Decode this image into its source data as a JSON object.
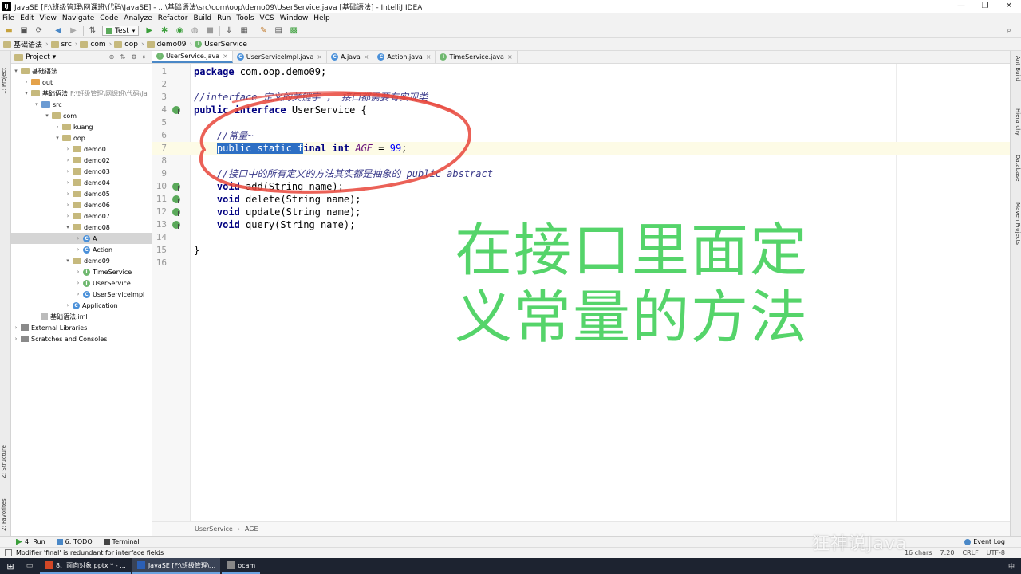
{
  "window": {
    "title": "JavaSE [F:\\班级管理\\网课班\\代码\\JavaSE] - ...\\基础语法\\src\\com\\oop\\demo09\\UserService.java [基础语法] - IntelliJ IDEA",
    "app_icon": "IJ"
  },
  "menu": [
    "File",
    "Edit",
    "View",
    "Navigate",
    "Code",
    "Analyze",
    "Refactor",
    "Build",
    "Run",
    "Tools",
    "VCS",
    "Window",
    "Help"
  ],
  "toolbar": {
    "run_config": "Test"
  },
  "breadcrumb": [
    "基础语法",
    "src",
    "com",
    "oop",
    "demo09",
    "UserService"
  ],
  "project_panel": {
    "title": "Project ▾",
    "tree": [
      {
        "label": "基础语法",
        "depth": 0,
        "arrow": "▾",
        "icon": "folder",
        "hint": ""
      },
      {
        "label": "out",
        "depth": 1,
        "arrow": "›",
        "icon": "folder-orange",
        "hint": ""
      },
      {
        "label": "基础语法",
        "depth": 1,
        "arrow": "▾",
        "icon": "folder",
        "hint": "F:\\班级管理\\网课班\\代码\\Ja"
      },
      {
        "label": "src",
        "depth": 2,
        "arrow": "▾",
        "icon": "folder-blue",
        "hint": ""
      },
      {
        "label": "com",
        "depth": 3,
        "arrow": "▾",
        "icon": "folder",
        "hint": ""
      },
      {
        "label": "kuang",
        "depth": 4,
        "arrow": "›",
        "icon": "folder",
        "hint": ""
      },
      {
        "label": "oop",
        "depth": 4,
        "arrow": "▾",
        "icon": "folder",
        "hint": ""
      },
      {
        "label": "demo01",
        "depth": 5,
        "arrow": "›",
        "icon": "folder",
        "hint": ""
      },
      {
        "label": "demo02",
        "depth": 5,
        "arrow": "›",
        "icon": "folder",
        "hint": ""
      },
      {
        "label": "demo03",
        "depth": 5,
        "arrow": "›",
        "icon": "folder",
        "hint": ""
      },
      {
        "label": "demo04",
        "depth": 5,
        "arrow": "›",
        "icon": "folder",
        "hint": ""
      },
      {
        "label": "demo05",
        "depth": 5,
        "arrow": "›",
        "icon": "folder",
        "hint": ""
      },
      {
        "label": "demo06",
        "depth": 5,
        "arrow": "›",
        "icon": "folder",
        "hint": ""
      },
      {
        "label": "demo07",
        "depth": 5,
        "arrow": "›",
        "icon": "folder",
        "hint": ""
      },
      {
        "label": "demo08",
        "depth": 5,
        "arrow": "▾",
        "icon": "folder",
        "hint": ""
      },
      {
        "label": "A",
        "depth": 6,
        "arrow": "›",
        "icon": "class",
        "hint": "",
        "selected": true
      },
      {
        "label": "Action",
        "depth": 6,
        "arrow": "›",
        "icon": "class",
        "hint": ""
      },
      {
        "label": "demo09",
        "depth": 5,
        "arrow": "▾",
        "icon": "folder",
        "hint": ""
      },
      {
        "label": "TimeService",
        "depth": 6,
        "arrow": "›",
        "icon": "interface",
        "hint": ""
      },
      {
        "label": "UserService",
        "depth": 6,
        "arrow": "›",
        "icon": "interface",
        "hint": ""
      },
      {
        "label": "UserServiceImpl",
        "depth": 6,
        "arrow": "›",
        "icon": "class",
        "hint": ""
      },
      {
        "label": "Application",
        "depth": 5,
        "arrow": "›",
        "icon": "class",
        "hint": ""
      },
      {
        "label": "基础语法.iml",
        "depth": 2,
        "arrow": "",
        "icon": "file",
        "hint": ""
      },
      {
        "label": "External Libraries",
        "depth": 0,
        "arrow": "›",
        "icon": "lib",
        "hint": ""
      },
      {
        "label": "Scratches and Consoles",
        "depth": 0,
        "arrow": "›",
        "icon": "lib",
        "hint": ""
      }
    ]
  },
  "editor_tabs": [
    {
      "label": "UserService.java",
      "icon": "interface",
      "active": true
    },
    {
      "label": "UserServiceImpl.java",
      "icon": "class",
      "active": false
    },
    {
      "label": "A.java",
      "icon": "class",
      "active": false
    },
    {
      "label": "Action.java",
      "icon": "class",
      "active": false
    },
    {
      "label": "TimeService.java",
      "icon": "interface",
      "active": false
    }
  ],
  "code_lines": [
    {
      "n": "1",
      "mark": false,
      "current": false,
      "html": "<span class=\"kw\">package</span> com.oop.demo09;"
    },
    {
      "n": "2",
      "mark": false,
      "current": false,
      "html": ""
    },
    {
      "n": "3",
      "mark": false,
      "current": false,
      "html": "<span class=\"cm-dark\">//interface 定义的关键字 ， 接口都需要有实现类</span>"
    },
    {
      "n": "4",
      "mark": true,
      "current": false,
      "html": "<span class=\"kw\">public interface</span> UserService {"
    },
    {
      "n": "5",
      "mark": false,
      "current": false,
      "html": ""
    },
    {
      "n": "6",
      "mark": false,
      "current": false,
      "html": "    <span class=\"cm-dark\">//常量~</span>"
    },
    {
      "n": "7",
      "mark": false,
      "current": true,
      "html": "    <span class=\"sel\">public static f</span><span class=\"kw\">inal</span> <span class=\"kw\">int</span> <span class=\"fld\">AGE</span> = <span class=\"num\">99</span>;"
    },
    {
      "n": "8",
      "mark": false,
      "current": false,
      "html": ""
    },
    {
      "n": "9",
      "mark": false,
      "current": false,
      "html": "    <span class=\"cm-dark\">//接口中的所有定义的方法其实都是抽象的 public abstract</span>"
    },
    {
      "n": "10",
      "mark": true,
      "current": false,
      "html": "    <span class=\"kw\">void</span> add(String name);"
    },
    {
      "n": "11",
      "mark": true,
      "current": false,
      "html": "    <span class=\"kw\">void</span> delete(String name);"
    },
    {
      "n": "12",
      "mark": true,
      "current": false,
      "html": "    <span class=\"kw\">void</span> update(String name);"
    },
    {
      "n": "13",
      "mark": true,
      "current": false,
      "html": "    <span class=\"kw\">void</span> query(String name);"
    },
    {
      "n": "14",
      "mark": false,
      "current": false,
      "html": ""
    },
    {
      "n": "15",
      "mark": false,
      "current": false,
      "html": "}"
    },
    {
      "n": "16",
      "mark": false,
      "current": false,
      "html": ""
    }
  ],
  "overlay": {
    "line1": "在接口里面定",
    "line2": "义常量的方法"
  },
  "editor_breadcrumb": [
    "UserService",
    "AGE"
  ],
  "left_strip": {
    "project": "1: Project",
    "structure": "Z: Structure",
    "favorites": "2: Favorites"
  },
  "right_strip": {
    "ant": "Ant Build",
    "hierarchy": "Hierarchy",
    "database": "Database",
    "maven": "Maven Projects"
  },
  "bottom_tabs": {
    "run": "4: Run",
    "todo": "6: TODO",
    "terminal": "Terminal",
    "event_log": "Event Log"
  },
  "status": {
    "message": "Modifier 'final' is redundant for interface fields",
    "chars": "16 chars",
    "position": "7:20",
    "line_sep": "CRLF",
    "encoding": "UTF-8"
  },
  "watermark": "狂神说Java",
  "taskbar": {
    "tasks": [
      {
        "label": "8、面向对象.pptx * - ...",
        "active": false
      },
      {
        "label": "JavaSE [F:\\班级管理\\...",
        "active": true
      },
      {
        "label": "ocam",
        "active": false
      }
    ],
    "tray": [
      "中"
    ]
  },
  "colors": {
    "overlay_green": "#55d46a",
    "annotation_red": "#e8453a",
    "selection_blue": "#2d6fc4"
  }
}
